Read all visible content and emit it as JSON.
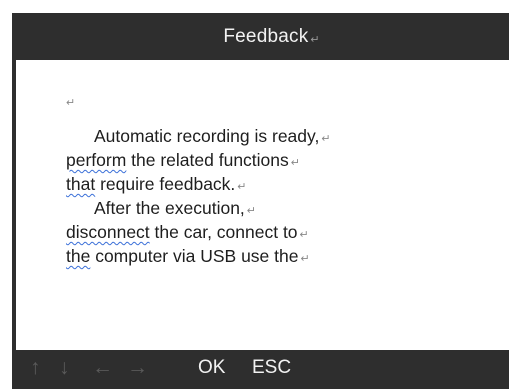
{
  "dialog": {
    "title": "Feedback",
    "paragraph_mark": "↵",
    "lines": [
      {
        "text": "Automatic recording is ready,",
        "squiggle": "",
        "indent": true
      },
      {
        "text": " the related functions",
        "squiggle": "perform",
        "indent": false
      },
      {
        "text": " require feedback.",
        "squiggle": "that",
        "indent": false
      },
      {
        "text": "After the execution,",
        "squiggle": "",
        "indent": true
      },
      {
        "text": " the car, connect to",
        "squiggle": "disconnect",
        "indent": false
      },
      {
        "text": " computer via USB use the",
        "squiggle": "the",
        "indent": false
      }
    ]
  },
  "footer": {
    "nav_icons": [
      {
        "name": "arrow-up-icon",
        "glyph": "↑"
      },
      {
        "name": "arrow-down-icon",
        "glyph": "↓"
      },
      {
        "name": "arrow-left-icon",
        "glyph": "←"
      },
      {
        "name": "arrow-right-icon",
        "glyph": "→"
      }
    ],
    "ok_label": "OK",
    "esc_label": "ESC"
  },
  "colors": {
    "frame": "#2e2e2e",
    "content_bg": "#ffffff",
    "title_text": "#f2f2f2",
    "body_text": "#1e1e1e",
    "nav_icon": "#5a5a5a",
    "spell_underline": "#3a6fd8"
  }
}
